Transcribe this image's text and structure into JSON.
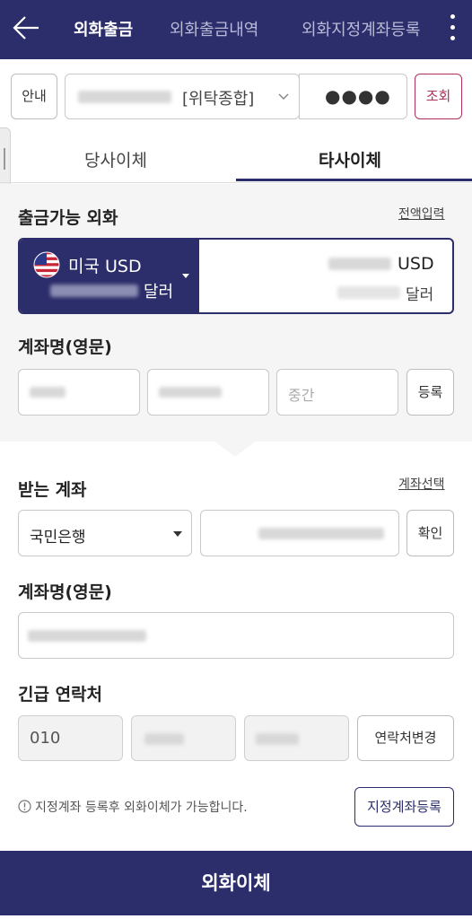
{
  "header": {
    "tabs": [
      {
        "label": "외화출금",
        "active": true
      },
      {
        "label": "외화출금내역",
        "active": false
      },
      {
        "label": "외화지정계좌등록",
        "active": false
      }
    ]
  },
  "account_row": {
    "guide_label": "안내",
    "account_type": "[위탁종합]",
    "password_mask": "●●●●",
    "inquiry_label": "조회"
  },
  "subtabs": [
    {
      "label": "당사이체",
      "active": false
    },
    {
      "label": "타사이체",
      "active": true
    }
  ],
  "available": {
    "title": "출금가능 외화",
    "full_input_link": "전액입력",
    "currency_label": "미국 USD",
    "left_unit": "달러",
    "right_currency": "USD",
    "right_unit": "달러"
  },
  "account_name_en": {
    "title": "계좌명(영문)",
    "middle_placeholder": "중간",
    "register_label": "등록"
  },
  "receiving": {
    "title": "받는 계좌",
    "select_account_link": "계좌선택",
    "bank_value": "국민은행",
    "confirm_label": "확인",
    "name_title": "계좌명(영문)"
  },
  "emergency": {
    "title": "긴급 연락처",
    "phone_prefix": "010",
    "change_label": "연락처변경"
  },
  "notice": {
    "text": "지정계좌 등록후 외화이체가 가능합니다.",
    "register_button": "지정계좌등록"
  },
  "submit_label": "외화이체",
  "colors": {
    "primary": "#2c2d6b",
    "background_grey": "#f5f5f5",
    "inquiry_accent": "#b0305a"
  }
}
